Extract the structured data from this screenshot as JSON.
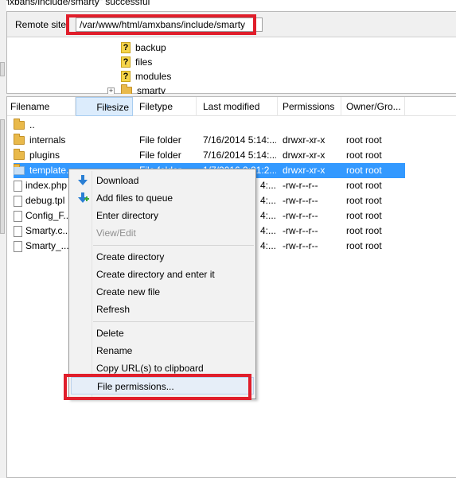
{
  "status": {
    "text": "mxbans/include/smarty\" successful"
  },
  "remote_site": {
    "label": "Remote site:",
    "path": "/var/www/html/amxbans/include/smarty"
  },
  "tree": [
    {
      "name": "backup",
      "icon": "question-icon"
    },
    {
      "name": "files",
      "icon": "question-icon"
    },
    {
      "name": "modules",
      "icon": "question-icon"
    },
    {
      "name": "smarty",
      "icon": "folder-icon",
      "expander": "+"
    }
  ],
  "columns": [
    "Filename",
    "Filesize",
    "Filetype",
    "Last modified",
    "Permissions",
    "Owner/Gro..."
  ],
  "rows": [
    {
      "name": "..",
      "type": "",
      "modified": "",
      "perms": "",
      "owner": "",
      "icon": "folder"
    },
    {
      "name": "internals",
      "type": "File folder",
      "modified": "7/16/2014 5:14:...",
      "perms": "drwxr-xr-x",
      "owner": "root root",
      "icon": "folder"
    },
    {
      "name": "plugins",
      "type": "File folder",
      "modified": "7/16/2014 5:14:...",
      "perms": "drwxr-xr-x",
      "owner": "root root",
      "icon": "folder"
    },
    {
      "name": "template...",
      "type": "File folder",
      "modified": "1/7/2016 2:21:2...",
      "perms": "drwxr-xr-x",
      "owner": "root root",
      "icon": "folder",
      "selected": true
    },
    {
      "name": "index.php",
      "type": "",
      "modified": "4:...",
      "perms": "-rw-r--r--",
      "owner": "root root",
      "icon": "file"
    },
    {
      "name": "debug.tpl",
      "type": "",
      "modified": "4:...",
      "perms": "-rw-r--r--",
      "owner": "root root",
      "icon": "file"
    },
    {
      "name": "Config_F...",
      "type": "",
      "modified": "4:...",
      "perms": "-rw-r--r--",
      "owner": "root root",
      "icon": "file"
    },
    {
      "name": "Smarty.c...",
      "type": "",
      "modified": "4:...",
      "perms": "-rw-r--r--",
      "owner": "root root",
      "icon": "file"
    },
    {
      "name": "Smarty_...",
      "type": "",
      "modified": "4:...",
      "perms": "-rw-r--r--",
      "owner": "root root",
      "icon": "file"
    }
  ],
  "context_menu": {
    "download": "Download",
    "add_to_queue": "Add files to queue",
    "enter_directory": "Enter directory",
    "view_edit": "View/Edit",
    "create_directory": "Create directory",
    "create_directory_enter": "Create directory and enter it",
    "create_new_file": "Create new file",
    "refresh": "Refresh",
    "delete": "Delete",
    "rename": "Rename",
    "copy_url": "Copy URL(s) to clipboard",
    "file_permissions": "File permissions..."
  },
  "colors": {
    "highlight": "#e01e2b",
    "selection": "#3399ff",
    "icon_blue": "#2a7fd4"
  }
}
